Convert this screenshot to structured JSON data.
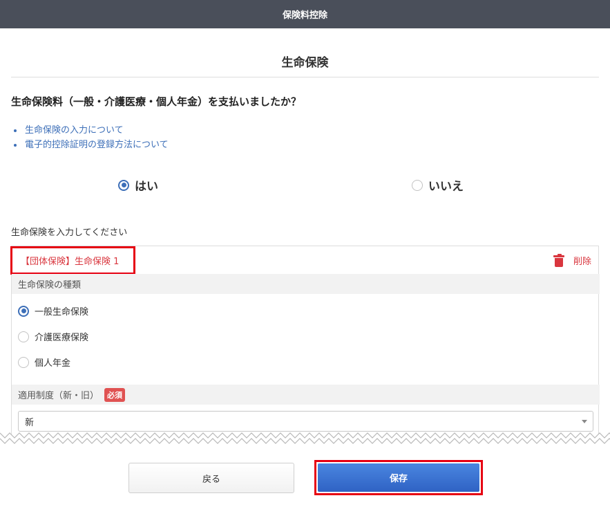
{
  "header": {
    "title": "保険料控除"
  },
  "section": {
    "title": "生命保険"
  },
  "question": "生命保険料（一般・介護医療・個人年金）を支払いましたか？",
  "links": [
    {
      "label": "生命保険の入力について"
    },
    {
      "label": "電子的控除証明の登録方法について"
    }
  ],
  "answer": {
    "yes_label": "はい",
    "no_label": "いいえ",
    "selected": "はい"
  },
  "prompt": "生命保険を入力してください",
  "card": {
    "title": "【団体保険】生命保険 1",
    "delete_label": "削除",
    "type_header": "生命保険の種類",
    "type_options": [
      {
        "label": "一般生命保険",
        "checked": true
      },
      {
        "label": "介護医療保険",
        "checked": false
      },
      {
        "label": "個人年金",
        "checked": false
      }
    ],
    "system_header": "適用制度（新・旧）",
    "required_badge": "必須",
    "system_value": "新"
  },
  "buttons": {
    "back_label": "戻る",
    "save_label": "保存"
  },
  "colors": {
    "header_bg": "#4a4f5a",
    "link": "#3d6fb8",
    "accent_red": "#d9363e",
    "highlight": "#e60012",
    "primary": "#2f62c4"
  }
}
